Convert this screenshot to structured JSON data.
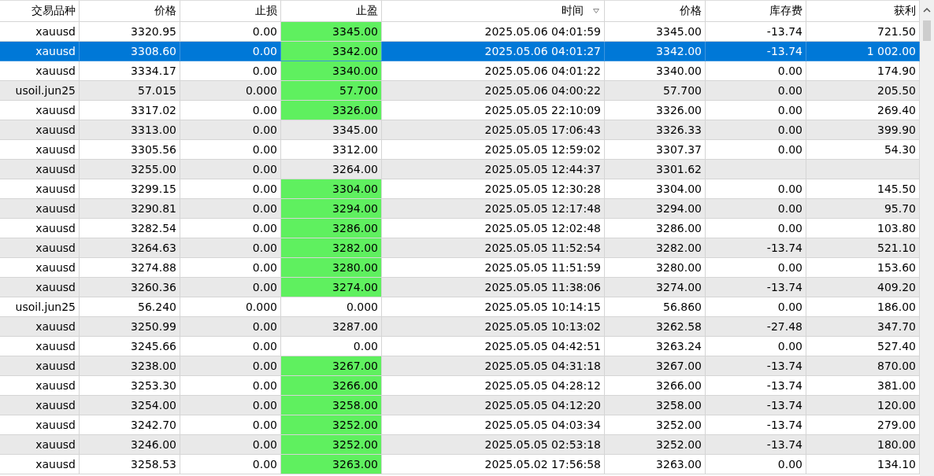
{
  "table": {
    "columns": [
      {
        "label": "交易品种",
        "sorted": false
      },
      {
        "label": "价格",
        "sorted": false
      },
      {
        "label": "止损",
        "sorted": false
      },
      {
        "label": "止盈",
        "sorted": false
      },
      {
        "label": "时间",
        "sorted": true
      },
      {
        "label": "价格",
        "sorted": false
      },
      {
        "label": "库存费",
        "sorted": false
      },
      {
        "label": "获利",
        "sorted": false
      }
    ],
    "rows": [
      {
        "cells": [
          "xauusd",
          "3320.95",
          "0.00",
          "3345.00",
          "2025.05.06 04:01:59",
          "3345.00",
          "-13.74",
          "721.50"
        ],
        "tp_hit": true,
        "selected": false
      },
      {
        "cells": [
          "xauusd",
          "3308.60",
          "0.00",
          "3342.00",
          "2025.05.06 04:01:27",
          "3342.00",
          "-13.74",
          "1 002.00"
        ],
        "tp_hit": true,
        "selected": true
      },
      {
        "cells": [
          "xauusd",
          "3334.17",
          "0.00",
          "3340.00",
          "2025.05.06 04:01:22",
          "3340.00",
          "0.00",
          "174.90"
        ],
        "tp_hit": true,
        "selected": false
      },
      {
        "cells": [
          "usoil.jun25",
          "57.015",
          "0.000",
          "57.700",
          "2025.05.06 04:00:22",
          "57.700",
          "0.00",
          "205.50"
        ],
        "tp_hit": true,
        "selected": false
      },
      {
        "cells": [
          "xauusd",
          "3317.02",
          "0.00",
          "3326.00",
          "2025.05.05 22:10:09",
          "3326.00",
          "0.00",
          "269.40"
        ],
        "tp_hit": true,
        "selected": false
      },
      {
        "cells": [
          "xauusd",
          "3313.00",
          "0.00",
          "3345.00",
          "2025.05.05 17:06:43",
          "3326.33",
          "0.00",
          "399.90"
        ],
        "tp_hit": false,
        "selected": false
      },
      {
        "cells": [
          "xauusd",
          "3305.56",
          "0.00",
          "3312.00",
          "2025.05.05 12:59:02",
          "3307.37",
          "0.00",
          "54.30"
        ],
        "tp_hit": false,
        "selected": false
      },
      {
        "cells": [
          "xauusd",
          "3255.00",
          "0.00",
          "3264.00",
          "2025.05.05 12:44:37",
          "3301.62"
        ],
        "tp_hit": false,
        "selected": false
      },
      {
        "cells": [
          "xauusd",
          "3299.15",
          "0.00",
          "3304.00",
          "2025.05.05 12:30:28",
          "3304.00",
          "0.00",
          "145.50"
        ],
        "tp_hit": true,
        "selected": false
      },
      {
        "cells": [
          "xauusd",
          "3290.81",
          "0.00",
          "3294.00",
          "2025.05.05 12:17:48",
          "3294.00",
          "0.00",
          "95.70"
        ],
        "tp_hit": true,
        "selected": false
      },
      {
        "cells": [
          "xauusd",
          "3282.54",
          "0.00",
          "3286.00",
          "2025.05.05 12:02:48",
          "3286.00",
          "0.00",
          "103.80"
        ],
        "tp_hit": true,
        "selected": false
      },
      {
        "cells": [
          "xauusd",
          "3264.63",
          "0.00",
          "3282.00",
          "2025.05.05 11:52:54",
          "3282.00",
          "-13.74",
          "521.10"
        ],
        "tp_hit": true,
        "selected": false
      },
      {
        "cells": [
          "xauusd",
          "3274.88",
          "0.00",
          "3280.00",
          "2025.05.05 11:51:59",
          "3280.00",
          "0.00",
          "153.60"
        ],
        "tp_hit": true,
        "selected": false
      },
      {
        "cells": [
          "xauusd",
          "3260.36",
          "0.00",
          "3274.00",
          "2025.05.05 11:38:06",
          "3274.00",
          "-13.74",
          "409.20"
        ],
        "tp_hit": true,
        "selected": false
      },
      {
        "cells": [
          "usoil.jun25",
          "56.240",
          "0.000",
          "0.000",
          "2025.05.05 10:14:15",
          "56.860",
          "0.00",
          "186.00"
        ],
        "tp_hit": false,
        "selected": false
      },
      {
        "cells": [
          "xauusd",
          "3250.99",
          "0.00",
          "3287.00",
          "2025.05.05 10:13:02",
          "3262.58",
          "-27.48",
          "347.70"
        ],
        "tp_hit": false,
        "selected": false
      },
      {
        "cells": [
          "xauusd",
          "3245.66",
          "0.00",
          "0.00",
          "2025.05.05 04:42:51",
          "3263.24",
          "0.00",
          "527.40"
        ],
        "tp_hit": false,
        "selected": false
      },
      {
        "cells": [
          "xauusd",
          "3238.00",
          "0.00",
          "3267.00",
          "2025.05.05 04:31:18",
          "3267.00",
          "-13.74",
          "870.00"
        ],
        "tp_hit": true,
        "selected": false
      },
      {
        "cells": [
          "xauusd",
          "3253.30",
          "0.00",
          "3266.00",
          "2025.05.05 04:28:12",
          "3266.00",
          "-13.74",
          "381.00"
        ],
        "tp_hit": true,
        "selected": false
      },
      {
        "cells": [
          "xauusd",
          "3254.00",
          "0.00",
          "3258.00",
          "2025.05.05 04:12:20",
          "3258.00",
          "-13.74",
          "120.00"
        ],
        "tp_hit": true,
        "selected": false
      },
      {
        "cells": [
          "xauusd",
          "3242.70",
          "0.00",
          "3252.00",
          "2025.05.05 04:03:34",
          "3252.00",
          "-13.74",
          "279.00"
        ],
        "tp_hit": true,
        "selected": false
      },
      {
        "cells": [
          "xauusd",
          "3246.00",
          "0.00",
          "3252.00",
          "2025.05.05 02:53:18",
          "3252.00",
          "-13.74",
          "180.00"
        ],
        "tp_hit": true,
        "selected": false
      },
      {
        "cells": [
          "xauusd",
          "3258.53",
          "0.00",
          "3263.00",
          "2025.05.02 17:56:58",
          "3263.00",
          "0.00",
          "134.10"
        ],
        "tp_hit": true,
        "selected": false
      }
    ]
  }
}
